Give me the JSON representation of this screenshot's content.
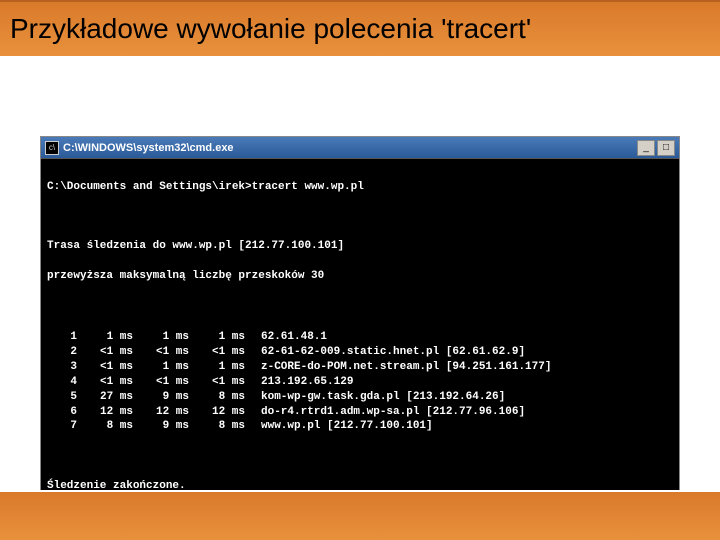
{
  "header": {
    "title": "Przykładowe wywołanie polecenia 'tracert'"
  },
  "cmd": {
    "window_title": "C:\\WINDOWS\\system32\\cmd.exe",
    "prompt_line": "C:\\Documents and Settings\\irek>tracert www.wp.pl",
    "trace_line1": "Trasa śledzenia do www.wp.pl [212.77.100.101]",
    "trace_line2": "przewyższa maksymalną liczbę przeskoków 30",
    "hops": [
      {
        "n": "1",
        "t1": "1 ms",
        "t2": "1 ms",
        "t3": "1 ms",
        "host": "62.61.48.1"
      },
      {
        "n": "2",
        "t1": "<1 ms",
        "t2": "<1 ms",
        "t3": "<1 ms",
        "host": "62-61-62-009.static.hnet.pl [62.61.62.9]"
      },
      {
        "n": "3",
        "t1": "<1 ms",
        "t2": "1 ms",
        "t3": "1 ms",
        "host": "z-CORE-do-POM.net.stream.pl [94.251.161.177]"
      },
      {
        "n": "4",
        "t1": "<1 ms",
        "t2": "<1 ms",
        "t3": "<1 ms",
        "host": "213.192.65.129"
      },
      {
        "n": "5",
        "t1": "27 ms",
        "t2": "9 ms",
        "t3": "8 ms",
        "host": "kom-wp-gw.task.gda.pl [213.192.64.26]"
      },
      {
        "n": "6",
        "t1": "12 ms",
        "t2": "12 ms",
        "t3": "12 ms",
        "host": "do-r4.rtrd1.adm.wp-sa.pl [212.77.96.106]"
      },
      {
        "n": "7",
        "t1": "8 ms",
        "t2": "9 ms",
        "t3": "8 ms",
        "host": "www.wp.pl [212.77.100.101]"
      }
    ],
    "done_line": "Śledzenie zakończone.",
    "controls": {
      "minimize": "_",
      "maximize": "□"
    },
    "icon_char": "c\\"
  }
}
